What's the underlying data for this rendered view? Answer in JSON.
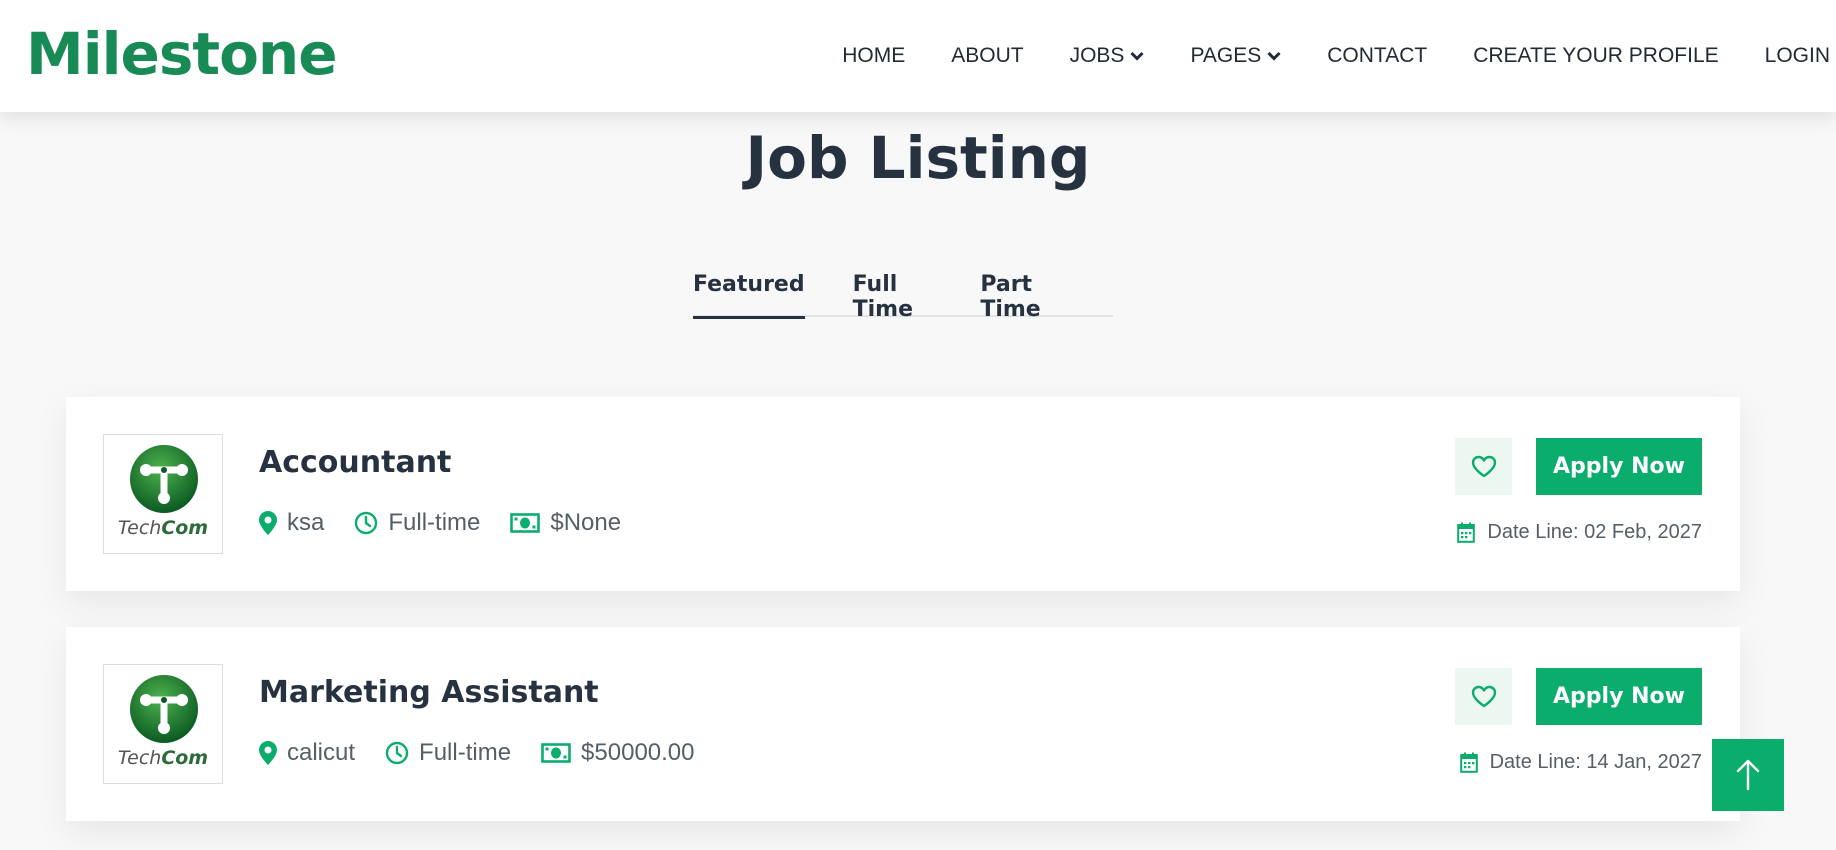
{
  "brand": {
    "name": "Milestone"
  },
  "nav": {
    "items": [
      {
        "label": "HOME"
      },
      {
        "label": "ABOUT"
      },
      {
        "label": "JOBS"
      },
      {
        "label": "PAGES"
      },
      {
        "label": "CONTACT"
      },
      {
        "label": "CREATE YOUR PROFILE"
      },
      {
        "label": "LOGIN"
      }
    ]
  },
  "page": {
    "title": "Job Listing"
  },
  "tabs": [
    {
      "label": "Featured",
      "active": true
    },
    {
      "label": "Full Time",
      "active": false
    },
    {
      "label": "Part Time",
      "active": false
    }
  ],
  "jobs": [
    {
      "company_logo_text": "TechCom",
      "title": "Accountant",
      "location": "ksa",
      "type": "Full-time",
      "salary": "$None",
      "deadline": "Date Line: 02 Feb, 2027",
      "apply_label": "Apply Now"
    },
    {
      "company_logo_text": "TechCom",
      "title": "Marketing Assistant",
      "location": "calicut",
      "type": "Full-time",
      "salary": "$50000.00",
      "deadline": "Date Line: 14 Jan, 2027",
      "apply_label": "Apply Now"
    }
  ],
  "icons": {
    "location": "map-pin-icon",
    "type": "clock-icon",
    "salary": "money-bill-icon",
    "favorite": "heart-icon",
    "deadline": "calendar-icon",
    "scroll_top": "arrow-up-icon",
    "dropdown": "chevron-down-icon"
  },
  "colors": {
    "brand": "#178a55",
    "accent": "#0aad6c",
    "heading": "#263240"
  }
}
